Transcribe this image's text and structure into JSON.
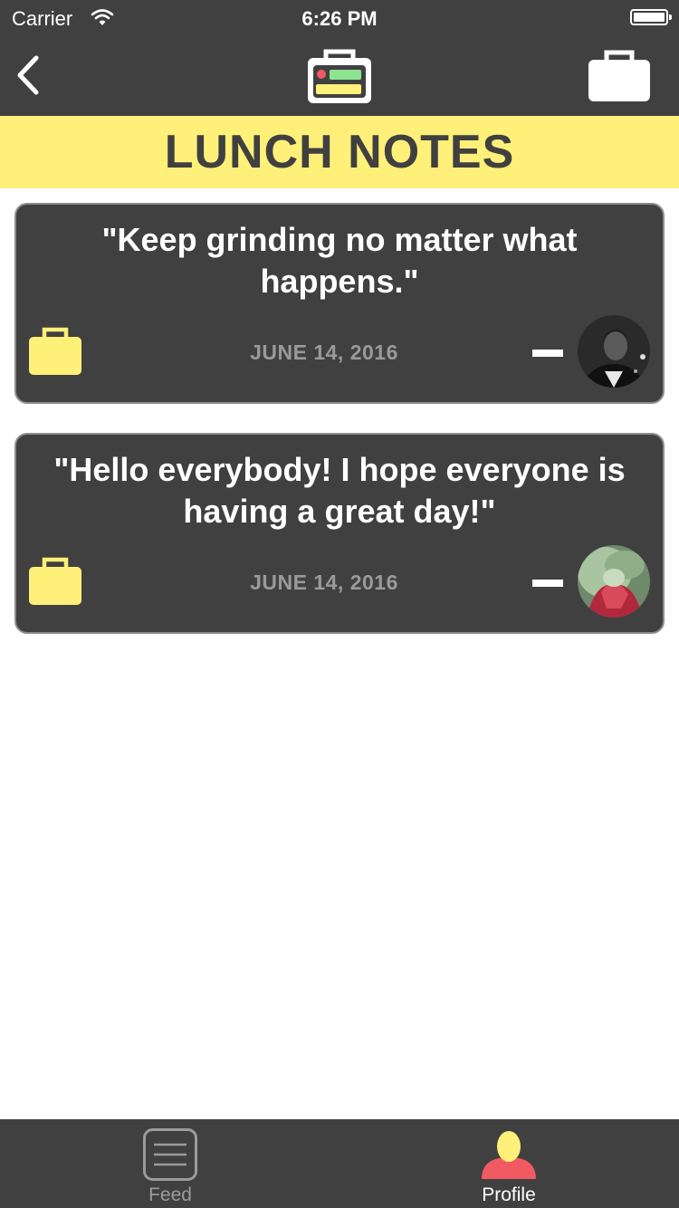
{
  "status_bar": {
    "carrier": "Carrier",
    "time": "6:26 PM",
    "wifi_icon": "wifi-icon",
    "battery_icon": "battery-icon"
  },
  "nav": {
    "back_icon": "chevron-left-icon",
    "center_icon": "lunchbox-icon",
    "right_icon": "briefcase-icon"
  },
  "banner": {
    "title": "LUNCH NOTES"
  },
  "notes": [
    {
      "quote": "\"Keep grinding no matter what happens.\"",
      "date": "JUNE 14, 2016",
      "icon": "lunchbox-icon"
    },
    {
      "quote": "\"Hello everybody! I hope everyone is having a great day!\"",
      "date": "JUNE 14, 2016",
      "icon": "lunchbox-icon"
    }
  ],
  "tabs": [
    {
      "label": "Feed",
      "icon": "feed-list-icon",
      "selected": false
    },
    {
      "label": "Profile",
      "icon": "profile-person-icon",
      "selected": true
    }
  ],
  "colors": {
    "dark": "#404040",
    "accent_yellow": "#fef078",
    "profile_red": "#f25a63",
    "muted_text": "#9a9a9a"
  }
}
